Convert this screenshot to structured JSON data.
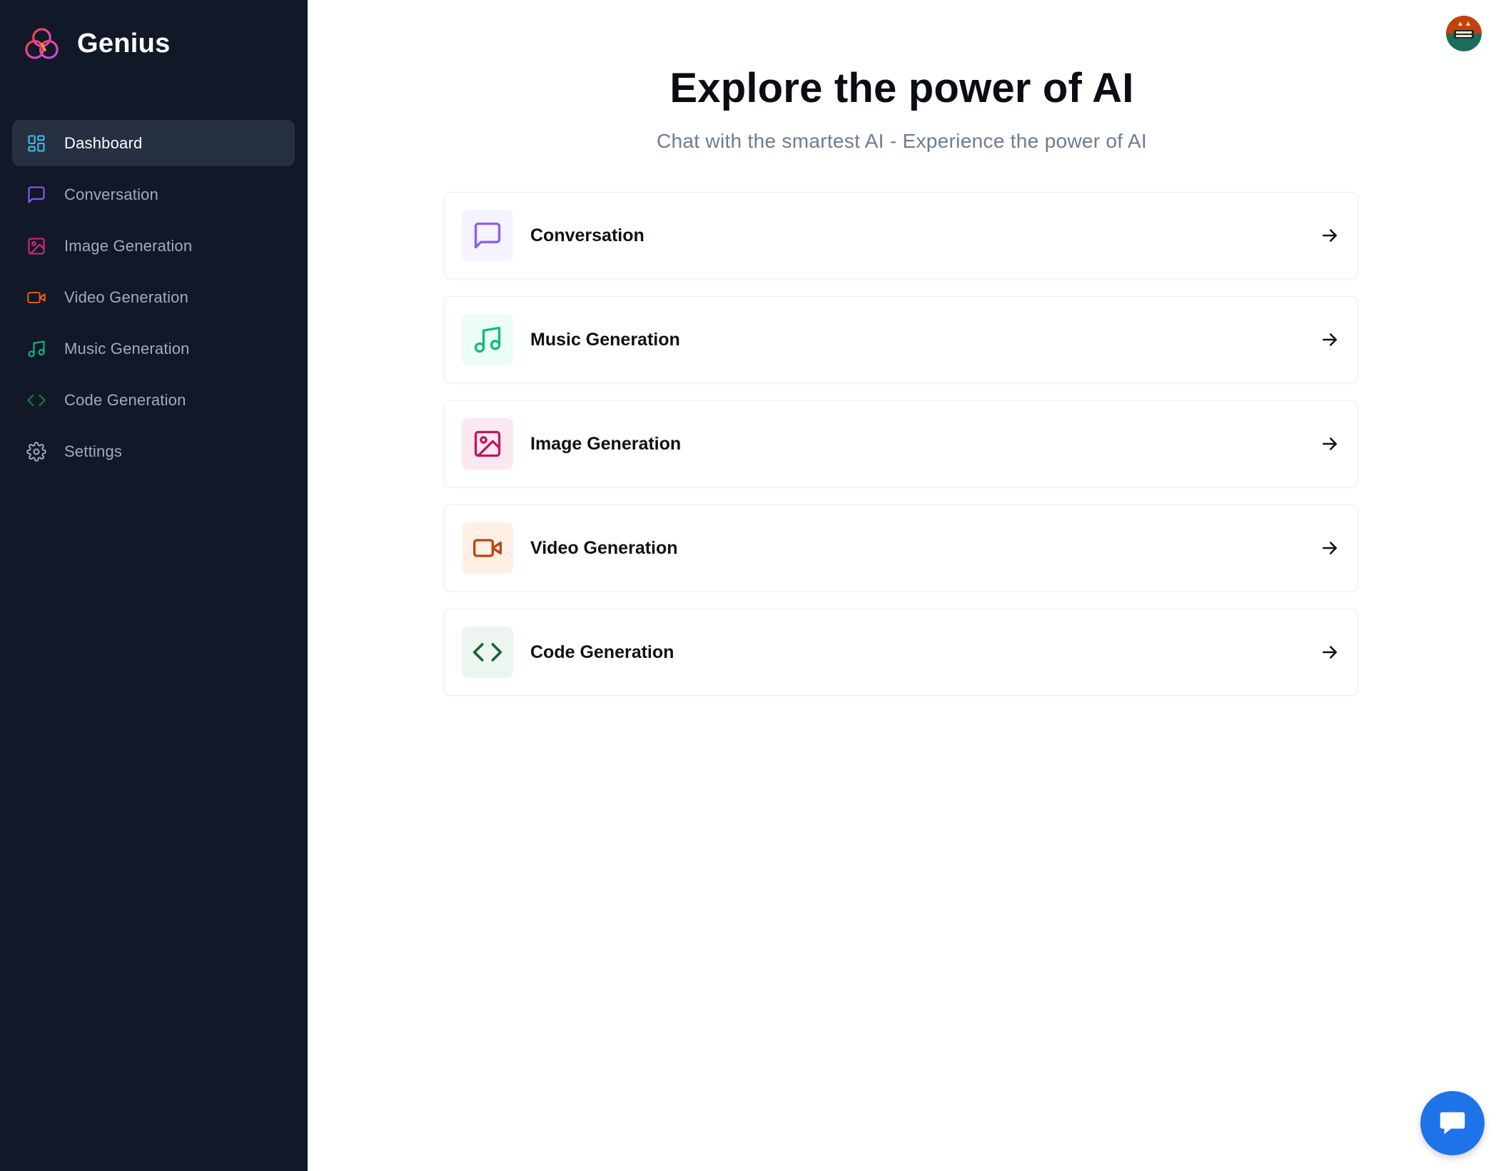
{
  "sidebar": {
    "brand_name": "Genius",
    "items": [
      {
        "label": "Dashboard",
        "icon": "layout-grid-icon",
        "color": "#38bdf8",
        "active": true
      },
      {
        "label": "Conversation",
        "icon": "message-square-icon",
        "color": "#8b5cf6",
        "active": false
      },
      {
        "label": "Image Generation",
        "icon": "image-icon",
        "color": "#db2777",
        "active": false
      },
      {
        "label": "Video Generation",
        "icon": "video-icon",
        "color": "#ea580c",
        "active": false
      },
      {
        "label": "Music Generation",
        "icon": "music-icon",
        "color": "#10b981",
        "active": false
      },
      {
        "label": "Code Generation",
        "icon": "code-icon",
        "color": "#15803d",
        "active": false
      },
      {
        "label": "Settings",
        "icon": "settings-icon",
        "color": "#a4abb7",
        "active": false
      }
    ]
  },
  "main": {
    "title": "Explore the power of AI",
    "subtitle": "Chat with the smartest AI - Experience the power of AI",
    "tools": [
      {
        "label": "Conversation",
        "icon": "message-square-icon",
        "color": "#8b5cf6",
        "bg": "#f5f3ff"
      },
      {
        "label": "Music Generation",
        "icon": "music-icon",
        "color": "#10b981",
        "bg": "#ecfdf5"
      },
      {
        "label": "Image Generation",
        "icon": "image-icon",
        "color": "#be185d",
        "bg": "#fce7f3"
      },
      {
        "label": "Video Generation",
        "icon": "video-icon",
        "color": "#c2410c",
        "bg": "#fff0e6"
      },
      {
        "label": "Code Generation",
        "icon": "code-icon",
        "color": "#166534",
        "bg": "#ecf5ef"
      }
    ]
  },
  "colors": {
    "sidebar_bg": "#111827",
    "active_item_bg": "#273040",
    "chat_button": "#1f73e8"
  }
}
